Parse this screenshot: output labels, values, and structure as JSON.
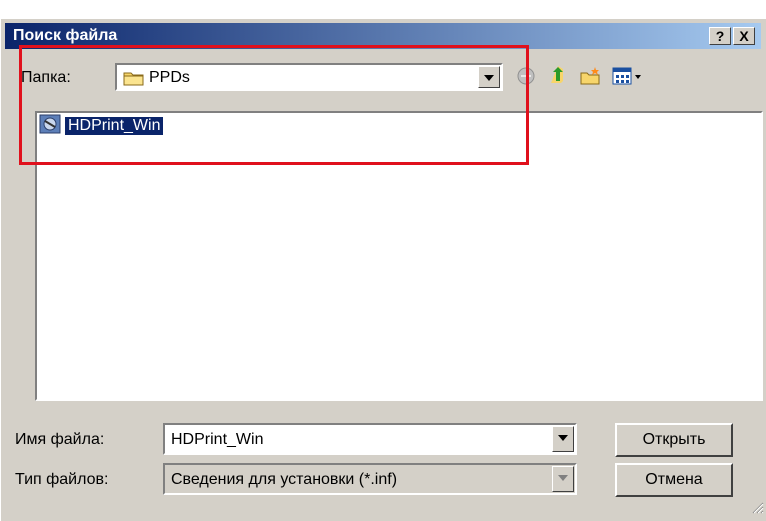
{
  "window": {
    "title": "Поиск файла"
  },
  "folder": {
    "label": "Папка:",
    "value": "PPDs"
  },
  "files": [
    {
      "name": "HDPrint_Win"
    }
  ],
  "filename": {
    "label": "Имя файла:",
    "value": "HDPrint_Win"
  },
  "filetype": {
    "label": "Тип файлов:",
    "value": "Сведения для установки (*.inf)"
  },
  "buttons": {
    "open": "Открыть",
    "cancel": "Отмена",
    "help": "?",
    "close": "X"
  },
  "colors": {
    "highlight": "#e0101c",
    "titlebar": "#0a246a",
    "selection": "#0a246a"
  },
  "icons": {
    "folder": "folder-icon",
    "back": "back-icon",
    "up": "up-folder-icon",
    "new_folder": "new-folder-icon",
    "view": "view-menu-icon"
  }
}
